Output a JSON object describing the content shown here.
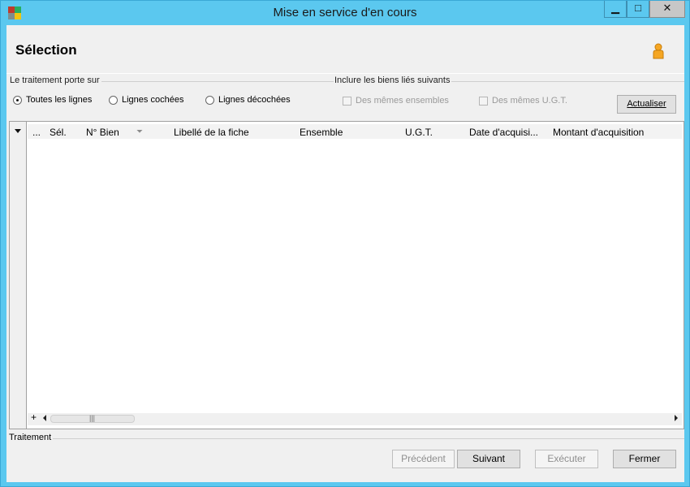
{
  "window": {
    "title": "Mise en service d'en cours",
    "controls": {
      "minimize": "▁",
      "maximize": "□",
      "close": "✕"
    },
    "accent_color": "#5bc8ef"
  },
  "header": {
    "title": "Sélection",
    "user_icon": "person-icon"
  },
  "options": {
    "scope_group_label": "Le traitement porte sur",
    "scope_radios": [
      {
        "label": "Toutes les lignes",
        "checked": true
      },
      {
        "label": "Lignes cochées",
        "checked": false
      },
      {
        "label": "Lignes décochées",
        "checked": false
      }
    ],
    "include_group_label": "Inclure les biens liés suivants",
    "include_checkboxes": [
      {
        "label": "Des mêmes ensembles",
        "checked": false,
        "enabled": false
      },
      {
        "label": "Des mêmes U.G.T.",
        "checked": false,
        "enabled": false
      }
    ],
    "refresh_button": "Actualiser"
  },
  "grid": {
    "columns": [
      "...",
      "Sél.",
      "N° Bien",
      "Libellé de la fiche",
      "Ensemble",
      "U.G.T.",
      "Date d'acquisi...",
      "Montant d'acquisition"
    ],
    "rows": [],
    "add_label": "+",
    "scroll_grip": "|||"
  },
  "footer": {
    "section_label": "Traitement",
    "buttons": {
      "previous": "Précédent",
      "next": "Suivant",
      "execute": "Exécuter",
      "close": "Fermer"
    }
  }
}
